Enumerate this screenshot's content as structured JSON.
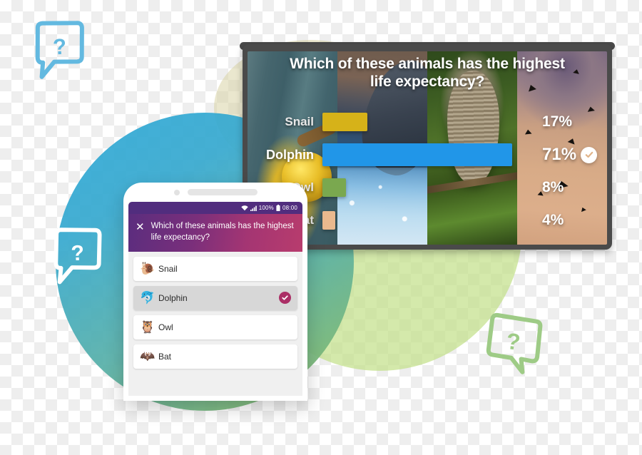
{
  "tv": {
    "question": "Which of these animals has the highest life expectancy?",
    "results": [
      {
        "label": "Snail",
        "percent": "17%",
        "bar_color": "#d6b219",
        "bar_width": "21%",
        "winner": false
      },
      {
        "label": "Dolphin",
        "percent": "71%",
        "bar_color": "#2196e8",
        "bar_width": "88%",
        "winner": true
      },
      {
        "label": "Owl",
        "percent": "8%",
        "bar_color": "#7aa84f",
        "bar_width": "11%",
        "winner": false
      },
      {
        "label": "Bat",
        "percent": "4%",
        "bar_color": "#eab98e",
        "bar_width": "6%",
        "winner": false
      }
    ],
    "correct_badge_icon": "check-circle-icon"
  },
  "phone": {
    "status_bar": {
      "wifi_icon": "wifi-icon",
      "signal_icon": "cellular-signal-icon",
      "battery_percent": "100%",
      "battery_icon": "battery-full-icon",
      "time": "08:00"
    },
    "header": {
      "close_icon": "close-icon",
      "close_label": "✕",
      "question": "Which of these animals has the highest life expectancy?"
    },
    "options": [
      {
        "emoji": "🐌",
        "icon_name": "snail-emoji",
        "label": "Snail",
        "selected": false
      },
      {
        "emoji": "🐬",
        "icon_name": "dolphin-emoji",
        "label": "Dolphin",
        "selected": true
      },
      {
        "emoji": "🦉",
        "icon_name": "owl-emoji",
        "label": "Owl",
        "selected": false
      },
      {
        "emoji": "🦇",
        "icon_name": "bat-emoji",
        "label": "Bat",
        "selected": false
      }
    ],
    "selected_check_icon": "check-circle-icon"
  },
  "decorations": {
    "bubbles": [
      {
        "name": "speech-bubble-blue",
        "glyph": "?",
        "color": "#63b9e0"
      },
      {
        "name": "speech-bubble-white",
        "glyph": "?",
        "color": "#ffffff"
      },
      {
        "name": "speech-bubble-green",
        "glyph": "?",
        "color": "#9ecb86"
      }
    ],
    "blob_teal_color": "#37a9cf",
    "blob_green_color": "#c3e18a"
  },
  "bats": [
    "✈",
    "✈",
    "✈",
    "✈",
    "✈",
    "✈",
    "✈",
    "✈"
  ]
}
